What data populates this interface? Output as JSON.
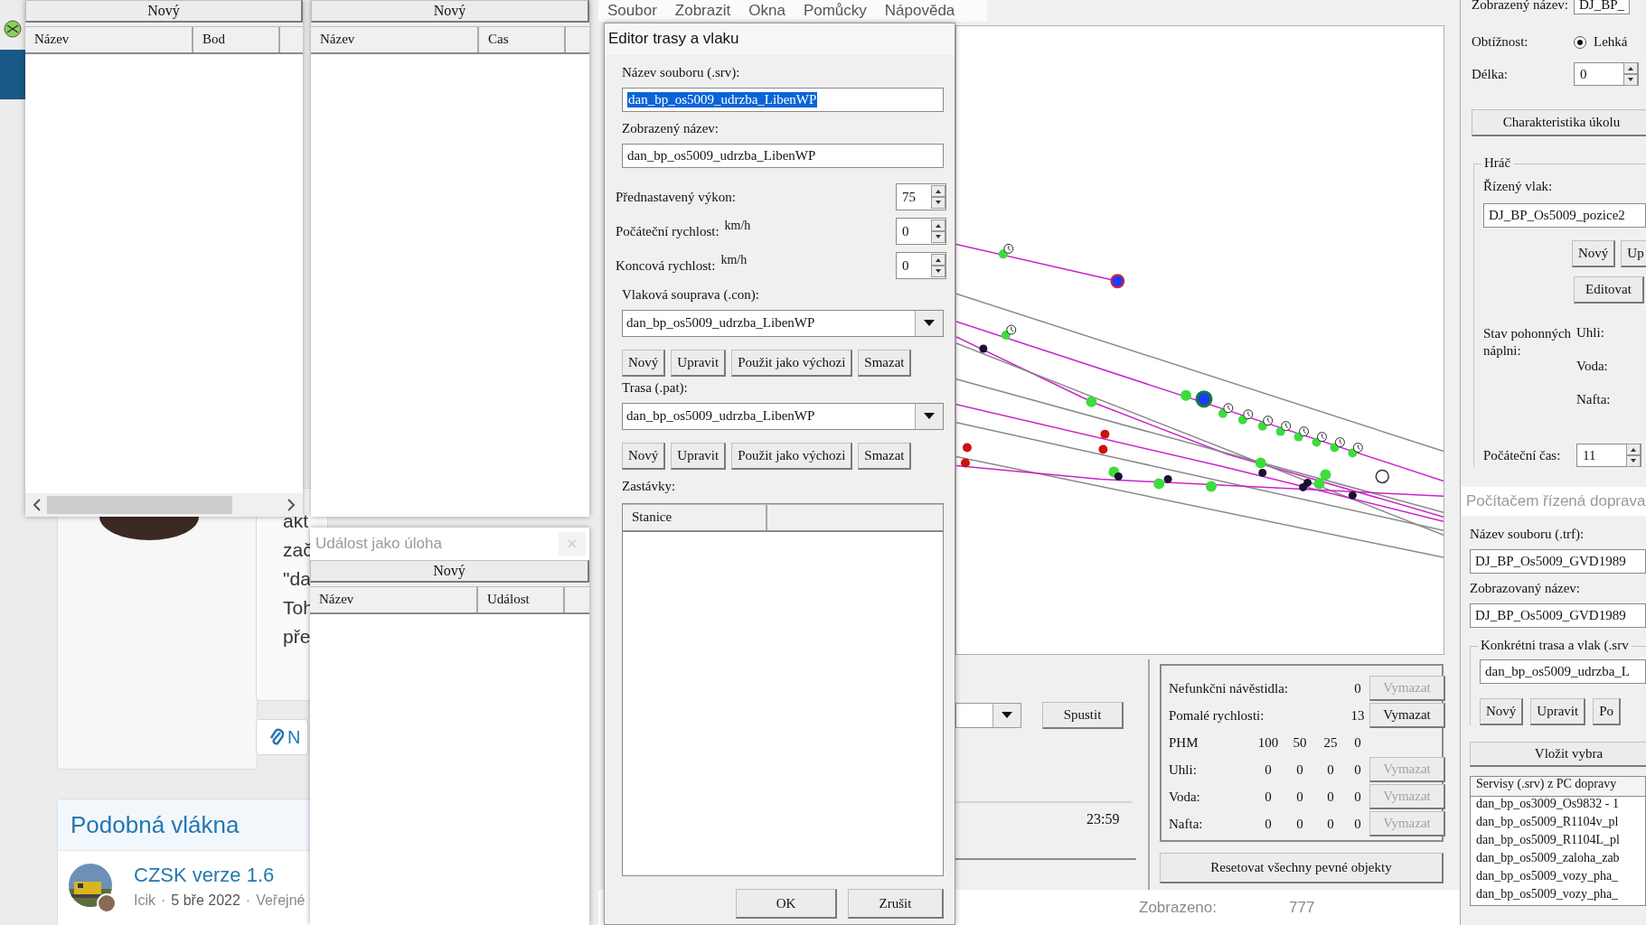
{
  "forum": {
    "post_fragments": [
      "akt",
      "zač",
      "\"da",
      "Toh",
      "pře"
    ],
    "attach_button": "N",
    "similar_heading": "Podobná vlákna",
    "thread": {
      "title": "CZSK verze 1.6",
      "author": "Icik",
      "separators": [
        "·",
        "·"
      ],
      "date": "5 bře 2022",
      "forum": "Veřejné"
    }
  },
  "list_windows": [
    {
      "button": "Nový",
      "columns": [
        "Název",
        "Bod"
      ],
      "horizontal_scrollbar": true
    },
    {
      "button": "Nový",
      "columns": [
        "Název",
        "Cas"
      ],
      "horizontal_scrollbar": false
    }
  ],
  "event_window": {
    "title": "Událost jako úloha",
    "button": "Nový",
    "columns": [
      "Název",
      "Událost"
    ]
  },
  "menu": [
    "Soubor",
    "Zobrazit",
    "Okna",
    "Pomůcky",
    "Nápověda"
  ],
  "editor": {
    "title": "Editor trasy a vlaku",
    "file_label": "Název souboru (.srv):",
    "file_value": "dan_bp_os5009_udrzba_LibenWP",
    "file_value_selected": true,
    "display_label": "Zobrazený název:",
    "display_value": "dan_bp_os5009_udrzba_LibenWP",
    "spinners": [
      {
        "label": "Přednastavený výkon:",
        "value": "75"
      },
      {
        "label": "Počáteční rychlost:",
        "unit": "km/h",
        "value": "0"
      },
      {
        "label": "Koncová rychlost:",
        "unit": "km/h",
        "value": "0"
      }
    ],
    "consist_label": "Vlaková souprava (.con):",
    "consist_value": "dan_bp_os5009_udrzba_LibenWP",
    "consist_buttons": [
      "Nový",
      "Upravit",
      "Použit jako výchozi",
      "Smazat"
    ],
    "path_label": "Trasa (.pat):",
    "path_value": "dan_bp_os5009_udrzba_LibenWP",
    "path_buttons": [
      "Nový",
      "Upravit",
      "Použit jako výchozi",
      "Smazat"
    ],
    "stops_label": "Zastávky:",
    "stops_columns": [
      "Stanice"
    ],
    "ok_button": "OK",
    "cancel_button": "Zrušit"
  },
  "run_panel": {
    "run_button": "Spustit",
    "time": "23:59"
  },
  "stats": {
    "rows": [
      {
        "kind": "count",
        "label": "Nefunkčni návěstidla:",
        "value": "0",
        "button": {
          "label": "Vymazat",
          "disabled": true
        }
      },
      {
        "kind": "count",
        "label": "Pomalé rychlosti:",
        "value": "13",
        "button": {
          "label": "Vymazat",
          "disabled": false
        }
      },
      {
        "kind": "header",
        "label": "PHM",
        "values": [
          "100",
          "50",
          "25",
          "0"
        ]
      },
      {
        "kind": "fuel",
        "label": "Uhli:",
        "values": [
          "0",
          "0",
          "0",
          "0"
        ],
        "button": {
          "label": "Vymazat",
          "disabled": true
        }
      },
      {
        "kind": "fuel",
        "label": "Voda:",
        "values": [
          "0",
          "0",
          "0",
          "0"
        ],
        "button": {
          "label": "Vymazat",
          "disabled": true
        }
      },
      {
        "kind": "fuel",
        "label": "Nafta:",
        "values": [
          "0",
          "0",
          "0",
          "0"
        ],
        "button": {
          "label": "Vymazat",
          "disabled": true
        }
      }
    ],
    "reset_button": "Resetovat všechny pevné objekty"
  },
  "status": {
    "label": "Zobrazeno:",
    "value": "777"
  },
  "right_panel": {
    "display_name_label": "Zobrazený název:",
    "display_name_value": "DJ_BP_",
    "difficulty_label": "Obtížnost:",
    "difficulty_option": {
      "label": "Lehká",
      "selected": true
    },
    "length_label": "Délka:",
    "length_value": "0",
    "characteristics_button": "Charakteristika úkolu",
    "player": {
      "group": "Hráč",
      "train_label": "Řízený vlak:",
      "train_value": "DJ_BP_Os5009_pozice2",
      "buttons": [
        "Nový",
        "Up"
      ],
      "edit_button": "Editovat",
      "fuel_state_label": "Stav pohonných náplni:",
      "fuel_labels": [
        "Uhli:",
        "Voda:",
        "Nafta:"
      ],
      "start_time_label": "Počáteční čas:",
      "start_time_value": "11"
    }
  },
  "ai_traffic": {
    "title": "Počítačem řízená doprava",
    "file_label": "Název souboru (.trf):",
    "file_value": "DJ_BP_Os5009_GVD1989",
    "name_label": "Zobrazovaný název:",
    "name_value": "DJ_BP_Os5009_GVD1989",
    "group": "Konkrétni trasa a vlak (.srv",
    "service_value": "dan_bp_os5009_udrzba_L",
    "buttons": [
      "Nový",
      "Upravit",
      "Po"
    ],
    "insert_button": "Vložit vybra",
    "list_header": "Servisy (.srv) z PC dopravy",
    "services": [
      "dan_bp_os3009_Os9832 - 1",
      "dan_bp_os5009_R1104v_pl",
      "dan_bp_os5009_R1104L_pl",
      "dan_bp_os5009_zaloha_zab",
      "dan_bp_os5009_vozy_pha_",
      "dan_bp_os5009_vozy_pha_"
    ]
  }
}
